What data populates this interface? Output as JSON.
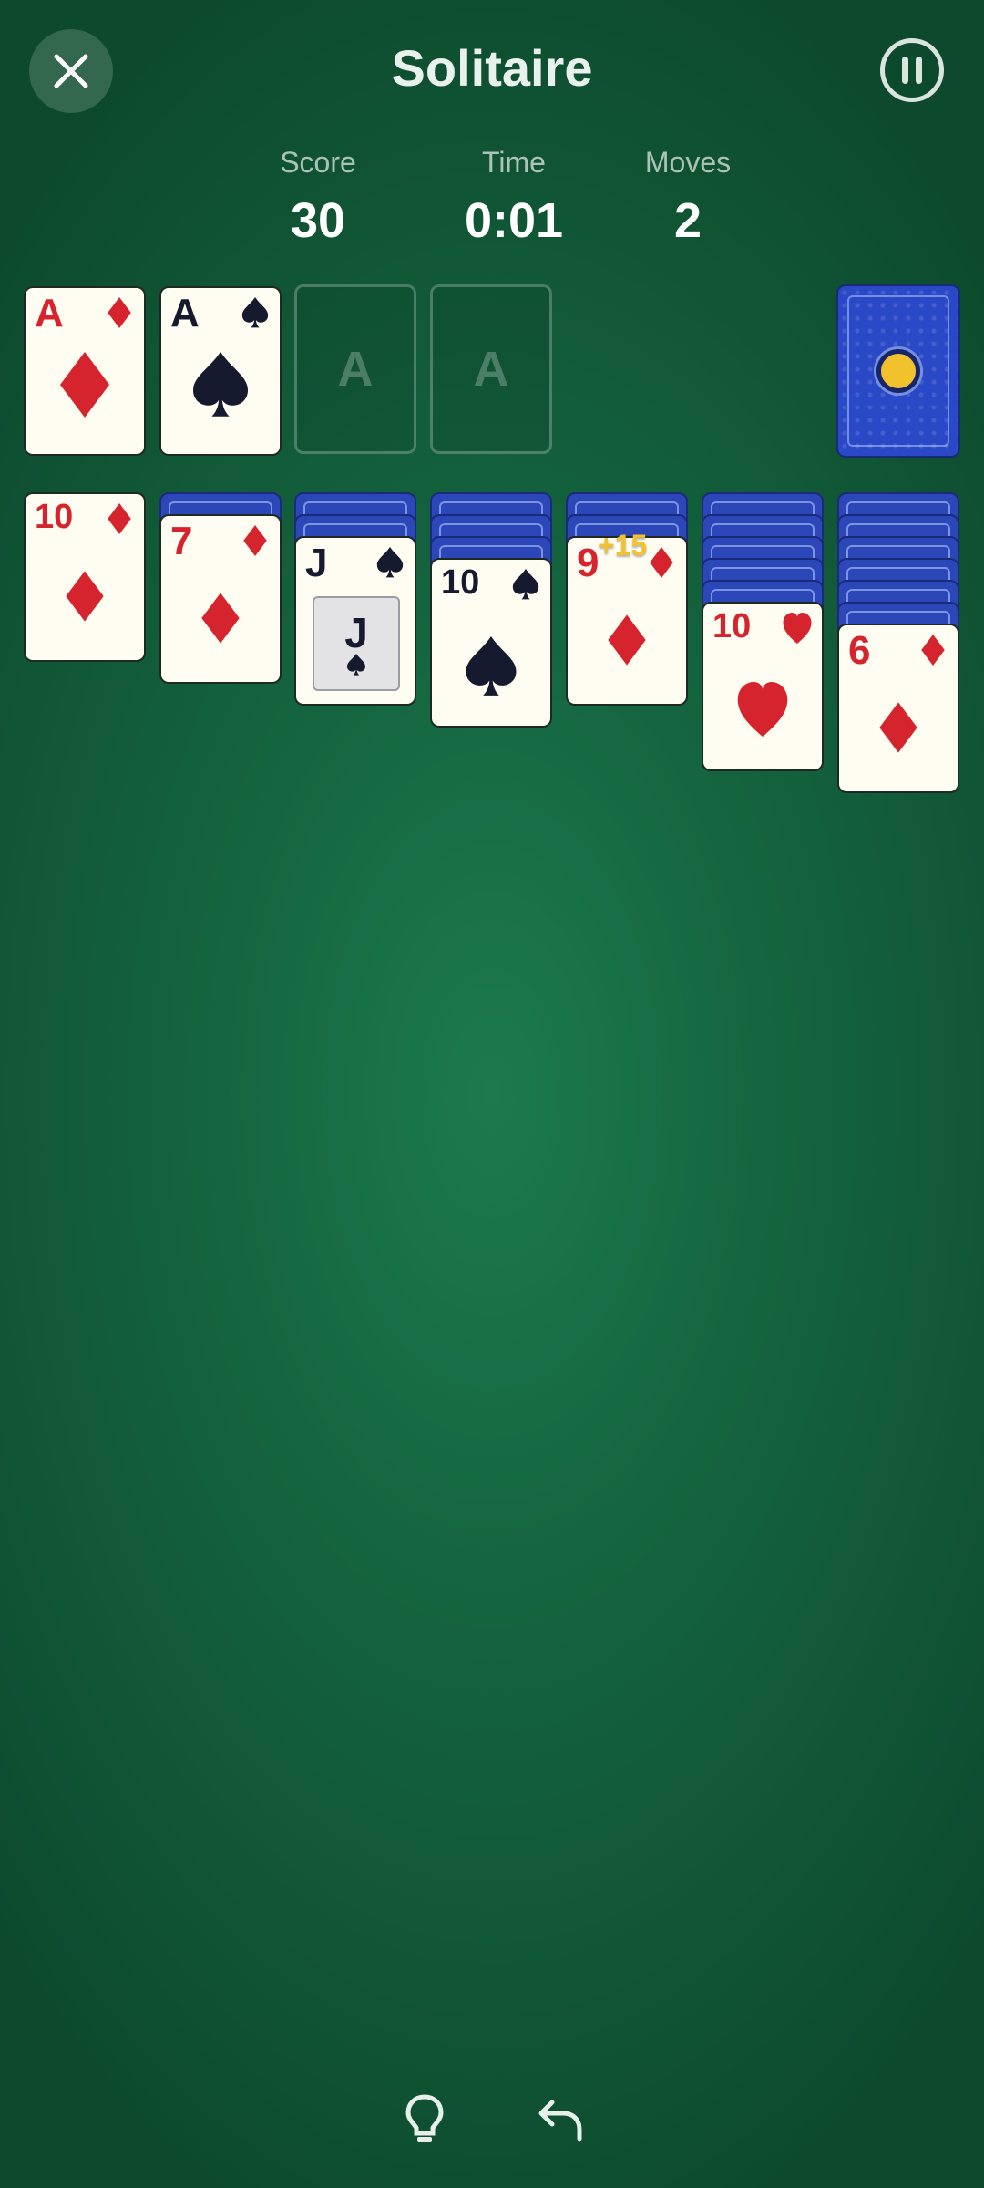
{
  "header": {
    "title": "Solitaire",
    "close_icon": "close-icon",
    "pause_icon": "pause-icon"
  },
  "stats": {
    "score_label": "Score",
    "score_value": "30",
    "time_label": "Time",
    "time_value": "0:01",
    "moves_label": "Moves",
    "moves_value": "2"
  },
  "foundations": [
    {
      "rank": "A",
      "suit": "diamond",
      "color": "#d6242e"
    },
    {
      "rank": "A",
      "suit": "spade",
      "color": "#151a2e"
    },
    {
      "placeholder": "A"
    },
    {
      "placeholder": "A"
    }
  ],
  "tableau": [
    {
      "facedown_count": 0,
      "top": {
        "rank": "10",
        "suit": "diamond"
      }
    },
    {
      "facedown_count": 1,
      "top": {
        "rank": "7",
        "suit": "diamond"
      }
    },
    {
      "facedown_count": 2,
      "top": {
        "rank": "J",
        "suit": "spade",
        "face_label": "J"
      }
    },
    {
      "facedown_count": 3,
      "top": {
        "rank": "10",
        "suit": "spade"
      }
    },
    {
      "facedown_count": 2,
      "top": {
        "rank": "9",
        "suit": "diamond"
      }
    },
    {
      "facedown_count": 5,
      "top": {
        "rank": "10",
        "suit": "heart"
      }
    },
    {
      "facedown_count": 6,
      "top": {
        "rank": "6",
        "suit": "diamond"
      }
    }
  ],
  "score_popup": "+15",
  "toolbar": {
    "hint_icon": "lightbulb-icon",
    "undo_icon": "undo-icon"
  },
  "colors": {
    "felt": "#14633e",
    "card_red": "#d6242e",
    "card_black": "#151a2e",
    "card_back": "#2b47b8",
    "accent_gold": "#f2c22d"
  }
}
